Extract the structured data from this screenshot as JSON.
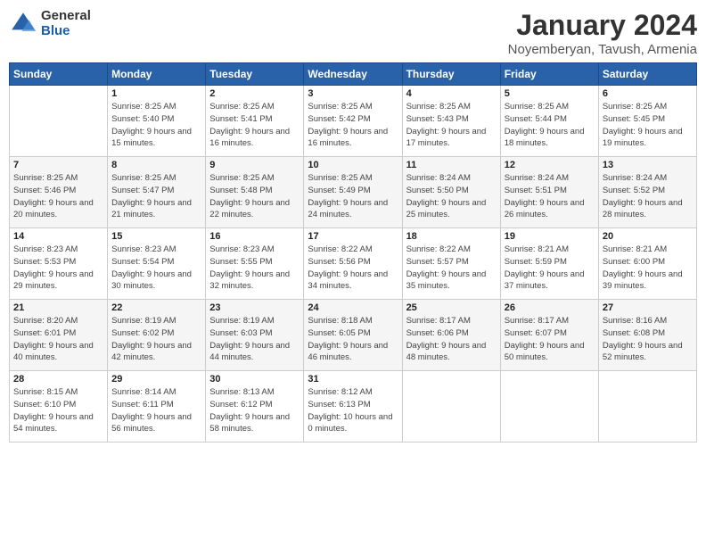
{
  "logo": {
    "general": "General",
    "blue": "Blue"
  },
  "title": "January 2024",
  "subtitle": "Noyemberyan, Tavush, Armenia",
  "headers": [
    "Sunday",
    "Monday",
    "Tuesday",
    "Wednesday",
    "Thursday",
    "Friday",
    "Saturday"
  ],
  "weeks": [
    [
      {
        "day": "",
        "sunrise": "",
        "sunset": "",
        "daylight": ""
      },
      {
        "day": "1",
        "sunrise": "Sunrise: 8:25 AM",
        "sunset": "Sunset: 5:40 PM",
        "daylight": "Daylight: 9 hours and 15 minutes."
      },
      {
        "day": "2",
        "sunrise": "Sunrise: 8:25 AM",
        "sunset": "Sunset: 5:41 PM",
        "daylight": "Daylight: 9 hours and 16 minutes."
      },
      {
        "day": "3",
        "sunrise": "Sunrise: 8:25 AM",
        "sunset": "Sunset: 5:42 PM",
        "daylight": "Daylight: 9 hours and 16 minutes."
      },
      {
        "day": "4",
        "sunrise": "Sunrise: 8:25 AM",
        "sunset": "Sunset: 5:43 PM",
        "daylight": "Daylight: 9 hours and 17 minutes."
      },
      {
        "day": "5",
        "sunrise": "Sunrise: 8:25 AM",
        "sunset": "Sunset: 5:44 PM",
        "daylight": "Daylight: 9 hours and 18 minutes."
      },
      {
        "day": "6",
        "sunrise": "Sunrise: 8:25 AM",
        "sunset": "Sunset: 5:45 PM",
        "daylight": "Daylight: 9 hours and 19 minutes."
      }
    ],
    [
      {
        "day": "7",
        "sunrise": "Sunrise: 8:25 AM",
        "sunset": "Sunset: 5:46 PM",
        "daylight": "Daylight: 9 hours and 20 minutes."
      },
      {
        "day": "8",
        "sunrise": "Sunrise: 8:25 AM",
        "sunset": "Sunset: 5:47 PM",
        "daylight": "Daylight: 9 hours and 21 minutes."
      },
      {
        "day": "9",
        "sunrise": "Sunrise: 8:25 AM",
        "sunset": "Sunset: 5:48 PM",
        "daylight": "Daylight: 9 hours and 22 minutes."
      },
      {
        "day": "10",
        "sunrise": "Sunrise: 8:25 AM",
        "sunset": "Sunset: 5:49 PM",
        "daylight": "Daylight: 9 hours and 24 minutes."
      },
      {
        "day": "11",
        "sunrise": "Sunrise: 8:24 AM",
        "sunset": "Sunset: 5:50 PM",
        "daylight": "Daylight: 9 hours and 25 minutes."
      },
      {
        "day": "12",
        "sunrise": "Sunrise: 8:24 AM",
        "sunset": "Sunset: 5:51 PM",
        "daylight": "Daylight: 9 hours and 26 minutes."
      },
      {
        "day": "13",
        "sunrise": "Sunrise: 8:24 AM",
        "sunset": "Sunset: 5:52 PM",
        "daylight": "Daylight: 9 hours and 28 minutes."
      }
    ],
    [
      {
        "day": "14",
        "sunrise": "Sunrise: 8:23 AM",
        "sunset": "Sunset: 5:53 PM",
        "daylight": "Daylight: 9 hours and 29 minutes."
      },
      {
        "day": "15",
        "sunrise": "Sunrise: 8:23 AM",
        "sunset": "Sunset: 5:54 PM",
        "daylight": "Daylight: 9 hours and 30 minutes."
      },
      {
        "day": "16",
        "sunrise": "Sunrise: 8:23 AM",
        "sunset": "Sunset: 5:55 PM",
        "daylight": "Daylight: 9 hours and 32 minutes."
      },
      {
        "day": "17",
        "sunrise": "Sunrise: 8:22 AM",
        "sunset": "Sunset: 5:56 PM",
        "daylight": "Daylight: 9 hours and 34 minutes."
      },
      {
        "day": "18",
        "sunrise": "Sunrise: 8:22 AM",
        "sunset": "Sunset: 5:57 PM",
        "daylight": "Daylight: 9 hours and 35 minutes."
      },
      {
        "day": "19",
        "sunrise": "Sunrise: 8:21 AM",
        "sunset": "Sunset: 5:59 PM",
        "daylight": "Daylight: 9 hours and 37 minutes."
      },
      {
        "day": "20",
        "sunrise": "Sunrise: 8:21 AM",
        "sunset": "Sunset: 6:00 PM",
        "daylight": "Daylight: 9 hours and 39 minutes."
      }
    ],
    [
      {
        "day": "21",
        "sunrise": "Sunrise: 8:20 AM",
        "sunset": "Sunset: 6:01 PM",
        "daylight": "Daylight: 9 hours and 40 minutes."
      },
      {
        "day": "22",
        "sunrise": "Sunrise: 8:19 AM",
        "sunset": "Sunset: 6:02 PM",
        "daylight": "Daylight: 9 hours and 42 minutes."
      },
      {
        "day": "23",
        "sunrise": "Sunrise: 8:19 AM",
        "sunset": "Sunset: 6:03 PM",
        "daylight": "Daylight: 9 hours and 44 minutes."
      },
      {
        "day": "24",
        "sunrise": "Sunrise: 8:18 AM",
        "sunset": "Sunset: 6:05 PM",
        "daylight": "Daylight: 9 hours and 46 minutes."
      },
      {
        "day": "25",
        "sunrise": "Sunrise: 8:17 AM",
        "sunset": "Sunset: 6:06 PM",
        "daylight": "Daylight: 9 hours and 48 minutes."
      },
      {
        "day": "26",
        "sunrise": "Sunrise: 8:17 AM",
        "sunset": "Sunset: 6:07 PM",
        "daylight": "Daylight: 9 hours and 50 minutes."
      },
      {
        "day": "27",
        "sunrise": "Sunrise: 8:16 AM",
        "sunset": "Sunset: 6:08 PM",
        "daylight": "Daylight: 9 hours and 52 minutes."
      }
    ],
    [
      {
        "day": "28",
        "sunrise": "Sunrise: 8:15 AM",
        "sunset": "Sunset: 6:10 PM",
        "daylight": "Daylight: 9 hours and 54 minutes."
      },
      {
        "day": "29",
        "sunrise": "Sunrise: 8:14 AM",
        "sunset": "Sunset: 6:11 PM",
        "daylight": "Daylight: 9 hours and 56 minutes."
      },
      {
        "day": "30",
        "sunrise": "Sunrise: 8:13 AM",
        "sunset": "Sunset: 6:12 PM",
        "daylight": "Daylight: 9 hours and 58 minutes."
      },
      {
        "day": "31",
        "sunrise": "Sunrise: 8:12 AM",
        "sunset": "Sunset: 6:13 PM",
        "daylight": "Daylight: 10 hours and 0 minutes."
      },
      {
        "day": "",
        "sunrise": "",
        "sunset": "",
        "daylight": ""
      },
      {
        "day": "",
        "sunrise": "",
        "sunset": "",
        "daylight": ""
      },
      {
        "day": "",
        "sunrise": "",
        "sunset": "",
        "daylight": ""
      }
    ]
  ]
}
